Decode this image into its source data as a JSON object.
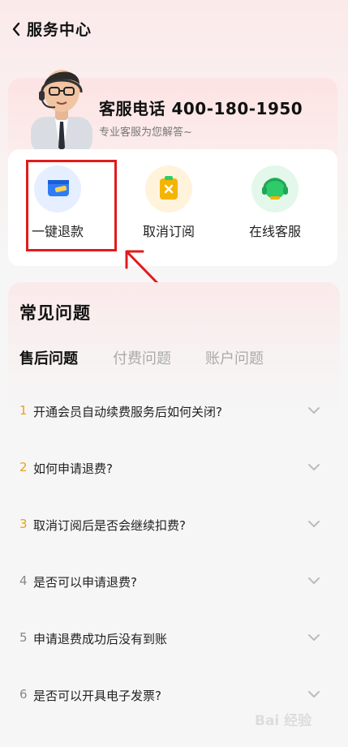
{
  "header": {
    "title": "服务中心"
  },
  "service": {
    "phone_title": "客服电话 400-180-1950",
    "subtitle": "专业客服为您解答~",
    "actions": [
      {
        "label": "一键退款",
        "icon": "refund-card-icon",
        "color": "#2f7df6"
      },
      {
        "label": "取消订阅",
        "icon": "cancel-subscription-icon",
        "color": "#f5b400"
      },
      {
        "label": "在线客服",
        "icon": "headset-icon",
        "color": "#2ecb6a"
      }
    ]
  },
  "faq": {
    "title": "常见问题",
    "tabs": [
      "售后问题",
      "付费问题",
      "账户问题"
    ],
    "active_tab": 0,
    "items": [
      {
        "num": "1",
        "text": "开通会员自动续费服务后如何关闭?"
      },
      {
        "num": "2",
        "text": "如何申请退费?"
      },
      {
        "num": "3",
        "text": "取消订阅后是否会继续扣费?"
      },
      {
        "num": "4",
        "text": "是否可以申请退费?"
      },
      {
        "num": "5",
        "text": "申请退费成功后没有到账"
      },
      {
        "num": "6",
        "text": "是否可以开具电子发票?"
      }
    ]
  },
  "watermark": "Bai 经验"
}
